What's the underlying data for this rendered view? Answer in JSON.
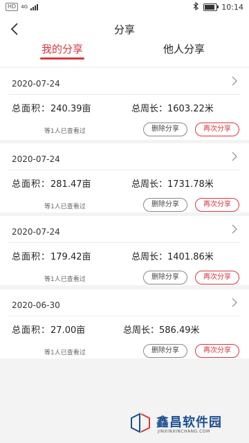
{
  "status_bar": {
    "left_chip": "HD",
    "network": "4G",
    "time": "10:14",
    "battery_level": 0.85,
    "bluetooth_icon": "bluetooth-icon"
  },
  "header": {
    "title": "分享",
    "back_icon": "chevron-left-icon",
    "tabs": [
      {
        "label": "我的分享",
        "active": true
      },
      {
        "label": "他人分享",
        "active": false
      }
    ]
  },
  "colors": {
    "accent": "#d9353b",
    "background": "#f3f3f3",
    "card": "#ffffff"
  },
  "shares": [
    {
      "date": "2020-07-24",
      "area_label": "总面积：",
      "area_value": "240.39亩",
      "perimeter_label": "总周长：",
      "perimeter_value": "1603.22米",
      "viewed": "等1人已查看过",
      "delete_label": "删除分享",
      "share_label": "再次分享"
    },
    {
      "date": "2020-07-24",
      "area_label": "总面积：",
      "area_value": "281.47亩",
      "perimeter_label": "总周长：",
      "perimeter_value": "1731.78米",
      "viewed": "等1人已查看过",
      "delete_label": "删除分享",
      "share_label": "再次分享"
    },
    {
      "date": "2020-07-24",
      "area_label": "总面积：",
      "area_value": "179.42亩",
      "perimeter_label": "总周长：",
      "perimeter_value": "1401.86米",
      "viewed": "等1人已查看过",
      "delete_label": "删除分享",
      "share_label": "再次分享"
    },
    {
      "date": "2020-06-30",
      "area_label": "总面积：",
      "area_value": "27.00亩",
      "perimeter_label": "总周长：",
      "perimeter_value": "586.49米",
      "viewed": "等1人已查看过",
      "delete_label": "删除分享",
      "share_label": "再次分享"
    }
  ],
  "watermark": {
    "name": "鑫昌软件园",
    "url": "JINXINXINCHANG.COM"
  }
}
